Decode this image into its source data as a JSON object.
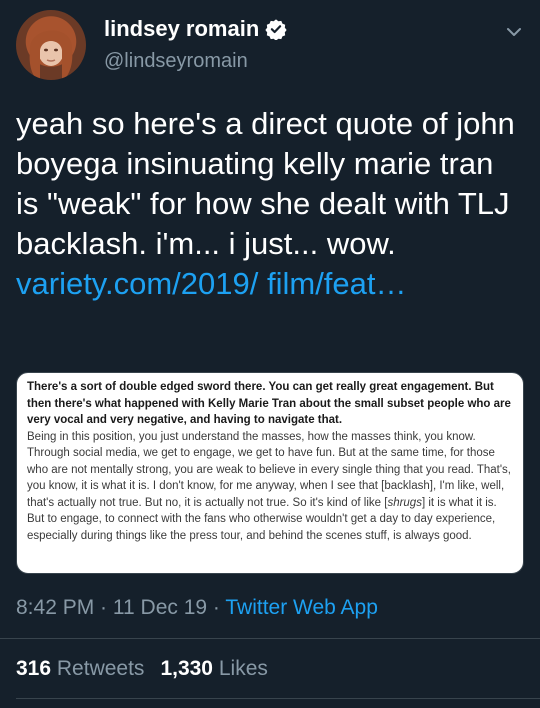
{
  "author": {
    "display_name": "lindsey romain",
    "handle": "@lindseyromain",
    "verified_icon": "verified-badge-icon",
    "colors": {
      "verified": "#ffffff"
    }
  },
  "tweet": {
    "text": "yeah so here's a direct quote of john boyega insinuating kelly marie tran is \"weak\" for how she dealt with TLJ backlash. i'm... i just... wow. ",
    "link": "variety.com/2019/ film/feat…"
  },
  "card": {
    "bold_text": "There's a sort of double edged sword there. You can get really great engagement. But then there's what happened with Kelly Marie Tran about the small subset people who are very vocal and very negative, and having to navigate that.",
    "body_text_1": "Being in this position, you just understand the masses, how the masses think, you know. Through social media, we get to engage, we get to have fun. But at the same time, for those who are not mentally strong, you are weak to believe in every single thing that you read. That's, you know, it is what it is. I don't know, for me anyway, when I see that [backlash], I'm like, well, that's actually not true. But no, it is actually not true. So it's kind of like [",
    "body_italic": "shrugs",
    "body_text_2": "] it is what it is. But to engage, to connect with the fans who otherwise wouldn't get a day to day experience, especially during things like the press tour, and behind the scenes stuff, is always good."
  },
  "meta": {
    "time": "8:42 PM",
    "sep1": " · ",
    "date": "11 Dec 19",
    "sep2": " · ",
    "source": "Twitter Web App"
  },
  "stats": {
    "retweets_count": "316",
    "retweets_label": "Retweets",
    "likes_count": "1,330",
    "likes_label": "Likes"
  },
  "colors": {
    "background": "#15202b",
    "link": "#1da1f2",
    "muted": "#8899a6"
  }
}
